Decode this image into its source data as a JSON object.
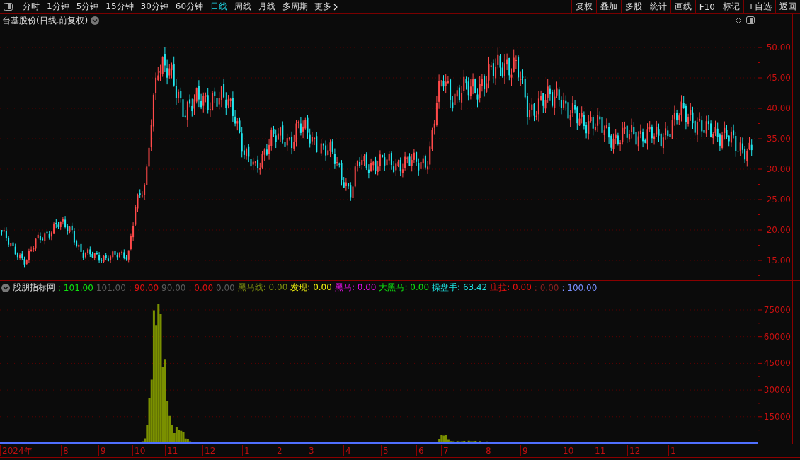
{
  "toolbar": {
    "periods": [
      {
        "label": "分时",
        "selected": false
      },
      {
        "label": "1分钟",
        "selected": false
      },
      {
        "label": "5分钟",
        "selected": false
      },
      {
        "label": "15分钟",
        "selected": false
      },
      {
        "label": "30分钟",
        "selected": false
      },
      {
        "label": "60分钟",
        "selected": false
      },
      {
        "label": "日线",
        "selected": true
      },
      {
        "label": "周线",
        "selected": false
      },
      {
        "label": "月线",
        "selected": false
      },
      {
        "label": "多周期",
        "selected": false
      }
    ],
    "more": "更多",
    "buttons": [
      "复权",
      "叠加",
      "多股",
      "统计",
      "画线",
      "F10",
      "标记",
      "+自选",
      "返回"
    ]
  },
  "chart": {
    "title": "台基股份(日线.前复权)",
    "price_ticks": [
      "50.00",
      "45.00",
      "40.00",
      "35.00",
      "30.00",
      "25.00",
      "20.00",
      "15.00"
    ]
  },
  "indicator": {
    "name": "股朋指标网",
    "legend": [
      {
        "text": ": 101.00",
        "color": "#10e010"
      },
      {
        "text": "101.00",
        "color": "#5c5c5c"
      },
      {
        "text": ": 90.00",
        "color": "#e01010"
      },
      {
        "text": "90.00",
        "color": "#5c5c5c"
      },
      {
        "text": ": 0.00",
        "color": "#e01010"
      },
      {
        "text": "0.00",
        "color": "#5c5c5c"
      },
      {
        "text": "黑马线: 0.00",
        "color": "#7f8f10"
      },
      {
        "text": "发现: 0.00",
        "color": "#f0f010"
      },
      {
        "text": "黑马: 0.00",
        "color": "#f010f0"
      },
      {
        "text": "大黑马: 0.00",
        "color": "#10e010"
      },
      {
        "text": "操盘手: 63.42",
        "color": "#20e0e0"
      },
      {
        "text": "庄拉: 0.00",
        "color": "#f01010"
      },
      {
        "text": ": 0.00",
        "color": "#8a2020"
      },
      {
        "text": ": 100.00",
        "color": "#7a90ff"
      }
    ],
    "ticks": [
      "75000",
      "60000",
      "45000",
      "30000",
      "15000"
    ]
  },
  "time_axis": {
    "labels": [
      "2024年",
      "8",
      "9",
      "10",
      "11",
      "12",
      "1",
      "2",
      "3",
      "4",
      "5",
      "6",
      "7",
      "8",
      "9",
      "10",
      "11",
      "12",
      "1"
    ]
  }
}
